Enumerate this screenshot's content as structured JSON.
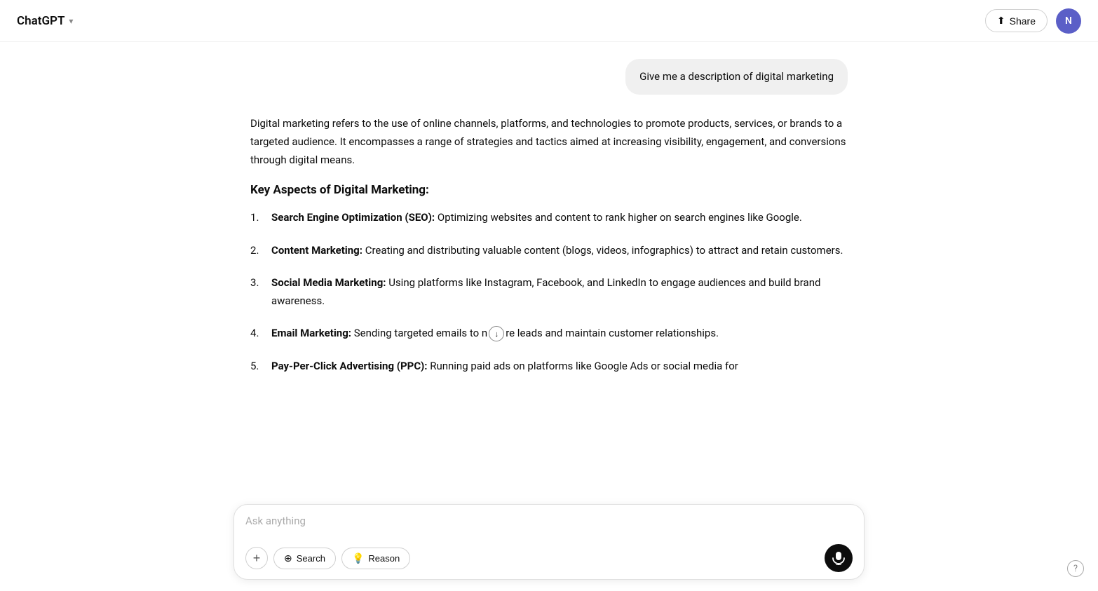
{
  "header": {
    "app_title": "ChatGPT",
    "chevron": "▾",
    "share_label": "Share",
    "avatar_letter": "N"
  },
  "chat": {
    "user_message": "Give me a description of digital marketing",
    "ai_response": {
      "intro": "Digital marketing refers to the use of online channels, platforms, and technologies to promote products, services, or brands to a targeted audience. It encompasses a range of strategies and tactics aimed at increasing visibility, engagement, and conversions through digital means.",
      "heading": "Key Aspects of Digital Marketing:",
      "items": [
        {
          "bold": "Search Engine Optimization (SEO):",
          "text": " Optimizing websites and content to rank higher on search engines like Google."
        },
        {
          "bold": "Content Marketing:",
          "text": " Creating and distributing valuable content (blogs, videos, infographics) to attract and retain customers."
        },
        {
          "bold": "Social Media Marketing:",
          "text": " Using platforms like Instagram, Facebook, and LinkedIn to engage audiences and build brand awareness."
        },
        {
          "bold": "Email Marketing:",
          "text": " Sending targeted emails to nurture leads and maintain customer relationships."
        },
        {
          "bold": "Pay-Per-Click Advertising (PPC):",
          "text": " Running paid ads on platforms like Google Ads or social media for..."
        }
      ]
    }
  },
  "input": {
    "placeholder": "Ask anything",
    "search_label": "Search",
    "reason_label": "Reason"
  },
  "icons": {
    "upload": "↑",
    "share": "↑",
    "chevron_down": "↓",
    "globe": "🌐",
    "lightbulb": "💡",
    "plus": "+",
    "microphone": "mic"
  }
}
